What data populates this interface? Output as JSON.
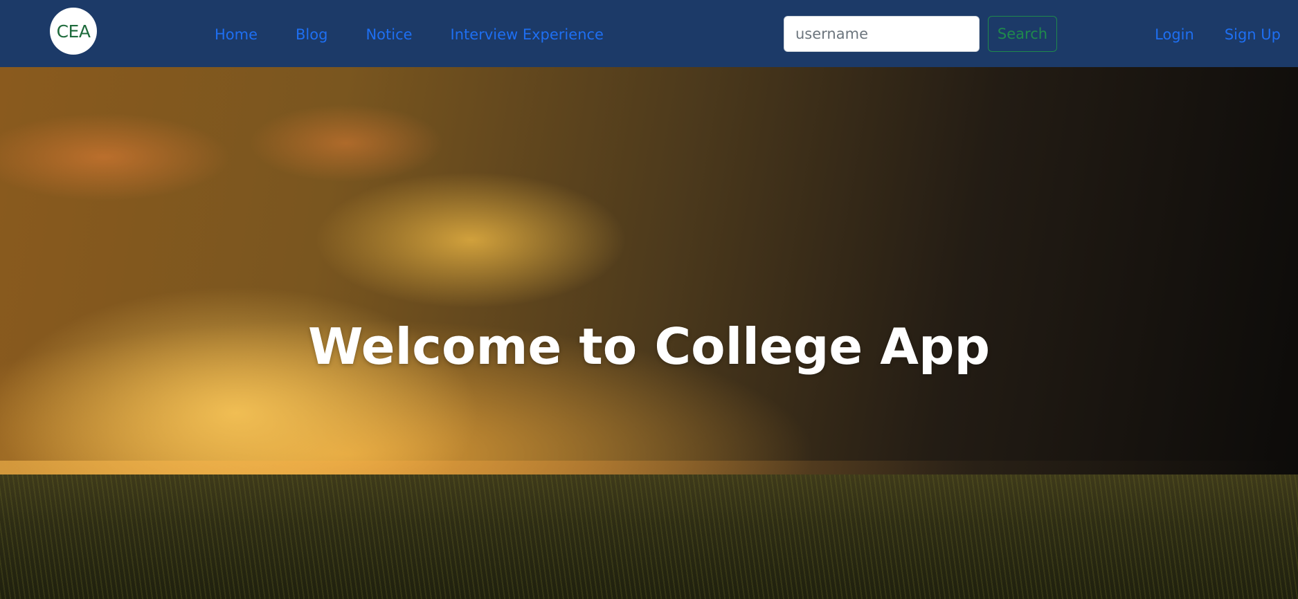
{
  "brand": {
    "logo_text": "CEA"
  },
  "nav": {
    "items": [
      {
        "label": "Home"
      },
      {
        "label": "Blog"
      },
      {
        "label": "Notice"
      },
      {
        "label": "Interview Experience"
      }
    ]
  },
  "search": {
    "placeholder": "username",
    "value": "",
    "button_label": "Search"
  },
  "auth": {
    "login_label": "Login",
    "signup_label": "Sign Up"
  },
  "hero": {
    "title": "Welcome to College App"
  },
  "colors": {
    "navbar_bg": "#1c3a68",
    "link": "#1e6ff2",
    "search_button": "#1f8a4c",
    "logo_text": "#1e6b3c"
  }
}
